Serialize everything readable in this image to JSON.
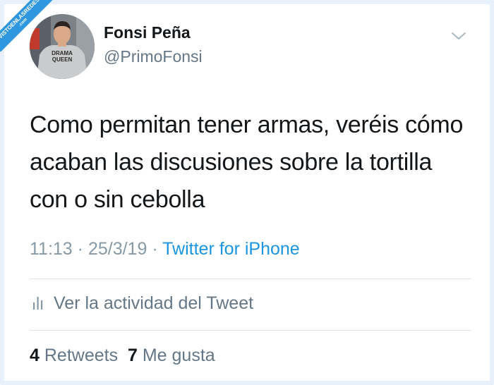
{
  "watermark": {
    "text": "VISTOENLASREDES",
    "sub": ".com"
  },
  "author": {
    "name": "Fonsi Peña",
    "handle": "@PrimoFonsi",
    "avatar_shirt_text_1": "DRAMA",
    "avatar_shirt_text_2": "QUEEN"
  },
  "tweet": {
    "text": "Como permitan tener armas, veréis cómo acaban las discusiones sobre la tortilla con o sin cebolla",
    "time": "11:13",
    "date": "25/3/19",
    "separator": "·",
    "source": "Twitter for iPhone"
  },
  "activity": {
    "label": "Ver la actividad del Tweet",
    "icon": "bar-chart-icon"
  },
  "stats": {
    "retweets_count": "4",
    "retweets_label": "Retweets",
    "likes_count": "7",
    "likes_label": "Me gusta"
  },
  "colors": {
    "link": "#1b95e0",
    "text": "#14171a",
    "secondary": "#657786",
    "watermark": "#2f97e0"
  }
}
